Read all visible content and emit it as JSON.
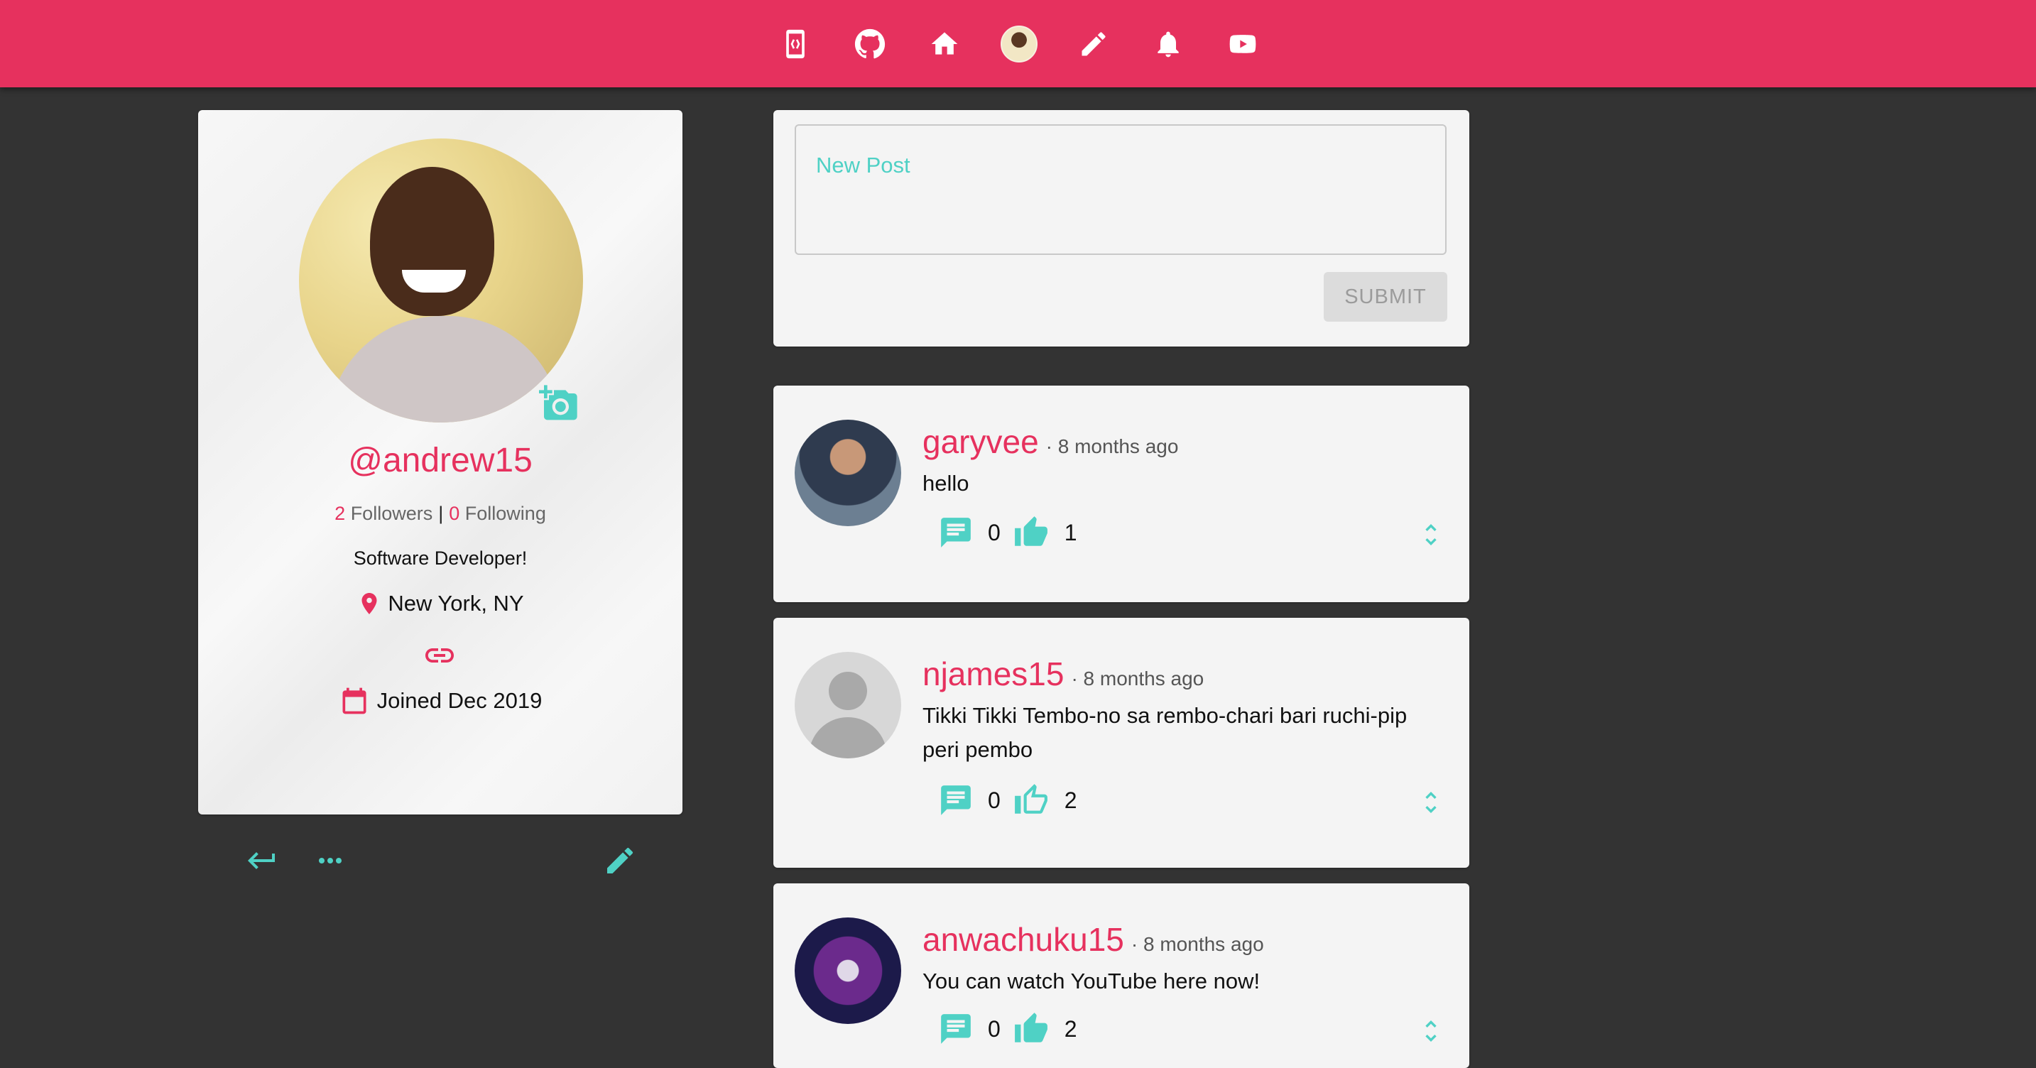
{
  "nav": {
    "icons": [
      "app-logo-icon",
      "github-icon",
      "home-icon",
      "avatar",
      "pencil-icon",
      "bell-icon",
      "youtube-icon"
    ]
  },
  "profile": {
    "handle": "@andrew15",
    "followers_count": "2",
    "followers_label": "Followers",
    "separator": "|",
    "following_count": "0",
    "following_label": "Following",
    "bio": "Software Developer!",
    "location": "New York, NY",
    "joined": "Joined Dec 2019"
  },
  "new_post": {
    "placeholder": "New Post",
    "submit_label": "SUBMIT"
  },
  "posts": [
    {
      "user": "garyvee",
      "time": "· 8 months ago",
      "body": "hello",
      "comments": "0",
      "likes": "1"
    },
    {
      "user": "njames15",
      "time": "· 8 months ago",
      "body": "Tikki Tikki Tembo-no sa rembo-chari bari ruchi-pip peri pembo",
      "comments": "0",
      "likes": "2"
    },
    {
      "user": "anwachuku15",
      "time": "· 8 months ago",
      "body": "You can watch YouTube here now!",
      "comments": "0",
      "likes": "2"
    }
  ],
  "colors": {
    "brand": "#e6315e",
    "accent": "#4fd1c5",
    "background": "#333333",
    "card": "#f4f4f4"
  }
}
